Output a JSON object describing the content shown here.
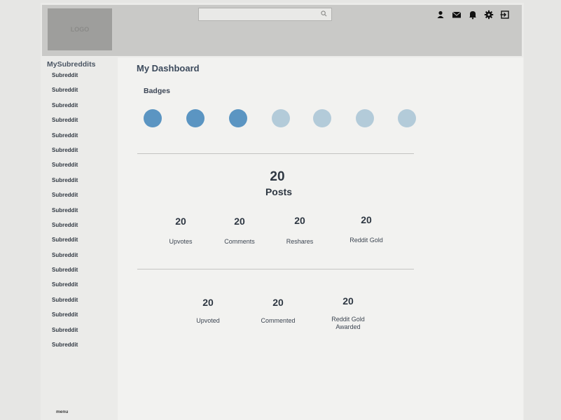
{
  "header": {
    "logo_text": "LOGO",
    "search": {
      "placeholder": ""
    },
    "icons": [
      "user-icon",
      "mail-icon",
      "bell-icon",
      "gear-icon",
      "logout-icon"
    ]
  },
  "sidebar": {
    "title": "MySubreddits",
    "items": [
      "Subreddit",
      "Subreddit",
      "Subreddit",
      "Subreddit",
      "Subreddit",
      "Subreddit",
      "Subreddit",
      "Subreddit",
      "Subreddit",
      "Subreddit",
      "Subreddit",
      "Subreddit",
      "Subreddit",
      "Subreddit",
      "Subreddit",
      "Subreddit",
      "Subreddit",
      "Subreddit",
      "Subreddit"
    ],
    "menu_label": "menu"
  },
  "dashboard": {
    "title": "My Dashboard",
    "badges": {
      "label": "Badges",
      "earned_color": "#5b95c2",
      "unearned_color": "#b3cbd9",
      "items": [
        {
          "earned": true
        },
        {
          "earned": true
        },
        {
          "earned": true
        },
        {
          "earned": false
        },
        {
          "earned": false
        },
        {
          "earned": false
        },
        {
          "earned": false
        }
      ]
    },
    "posts": {
      "value": "20",
      "label": "Posts"
    },
    "post_stats": [
      {
        "value": "20",
        "label": "Upvotes"
      },
      {
        "value": "20",
        "label": "Comments"
      },
      {
        "value": "20",
        "label": "Reshares"
      },
      {
        "value": "20",
        "label": "Reddit Gold"
      }
    ],
    "activity_stats": [
      {
        "value": "20",
        "label": "Upvoted"
      },
      {
        "value": "20",
        "label": "Commented"
      },
      {
        "value": "20",
        "label": "Reddit Gold Awarded"
      }
    ]
  }
}
